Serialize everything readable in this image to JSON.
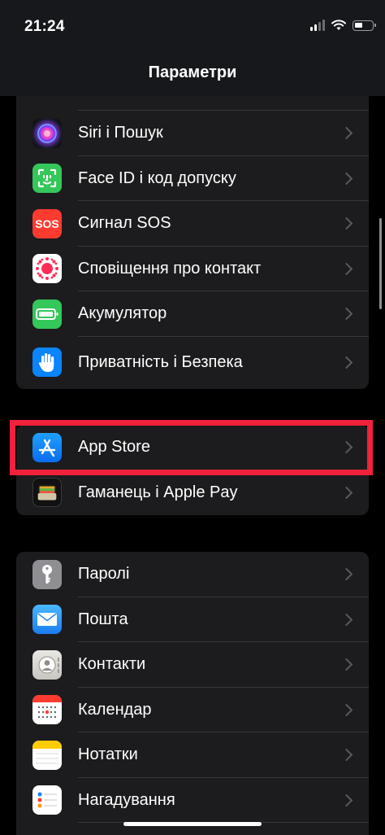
{
  "status_bar": {
    "time": "21:24"
  },
  "nav": {
    "title": "Параметри"
  },
  "group1": {
    "items": [
      {
        "label": "Siri і Пошук",
        "icon": "siri-icon"
      },
      {
        "label": "Face ID і код допуску",
        "icon": "face-id-icon"
      },
      {
        "label": "Сигнал SOS",
        "icon": "sos-icon",
        "icon_text": "SOS"
      },
      {
        "label": "Сповіщення про контакт",
        "icon": "exposure-notification-icon"
      },
      {
        "label": "Акумулятор",
        "icon": "battery-icon"
      },
      {
        "label": "Приватність і Безпека",
        "icon": "hand-icon"
      }
    ]
  },
  "group2": {
    "items": [
      {
        "label": "App Store",
        "icon": "app-store-icon"
      },
      {
        "label": "Гаманець і Apple Pay",
        "icon": "wallet-icon"
      }
    ]
  },
  "group3": {
    "items": [
      {
        "label": "Паролі",
        "icon": "key-icon"
      },
      {
        "label": "Пошта",
        "icon": "mail-icon"
      },
      {
        "label": "Контакти",
        "icon": "contacts-icon"
      },
      {
        "label": "Календар",
        "icon": "calendar-icon"
      },
      {
        "label": "Нотатки",
        "icon": "notes-icon"
      },
      {
        "label": "Нагадування",
        "icon": "reminders-icon"
      }
    ]
  },
  "colors": {
    "background": "#000000",
    "cell": "#1c1c1e",
    "separator": "#38383a",
    "highlight": "#f0213b"
  }
}
